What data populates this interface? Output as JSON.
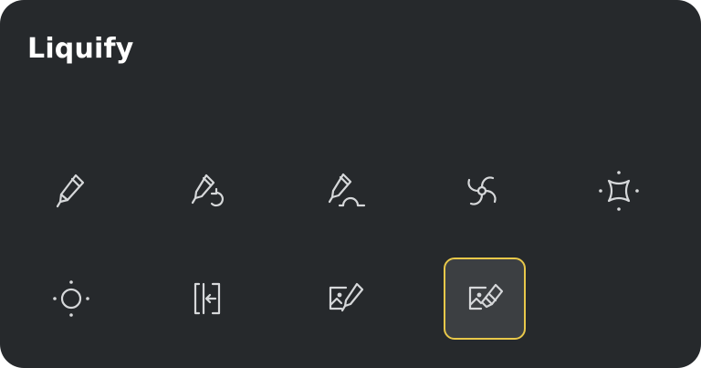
{
  "panel": {
    "title": "Liquify"
  },
  "tools": [
    {
      "id": "push",
      "icon": "brush-icon",
      "selected": false
    },
    {
      "id": "twirl",
      "icon": "brush-twirl-icon",
      "selected": false
    },
    {
      "id": "pinch",
      "icon": "brush-pinch-icon",
      "selected": false
    },
    {
      "id": "swirl",
      "icon": "swirl-icon",
      "selected": false
    },
    {
      "id": "contract",
      "icon": "pinch-star-icon",
      "selected": false
    },
    {
      "id": "expand",
      "icon": "expand-circle-icon",
      "selected": false
    },
    {
      "id": "crystals",
      "icon": "edge-arrow-icon",
      "selected": false
    },
    {
      "id": "reconstruct",
      "icon": "image-brush-icon",
      "selected": false
    },
    {
      "id": "reset",
      "icon": "image-eraser-icon",
      "selected": true
    }
  ],
  "colors": {
    "panel_background": "#26292c",
    "title": "#ffffff",
    "icon_stroke": "#d6d8da",
    "selected_background": "#3c3f42",
    "selected_border": "#e8c84a"
  }
}
